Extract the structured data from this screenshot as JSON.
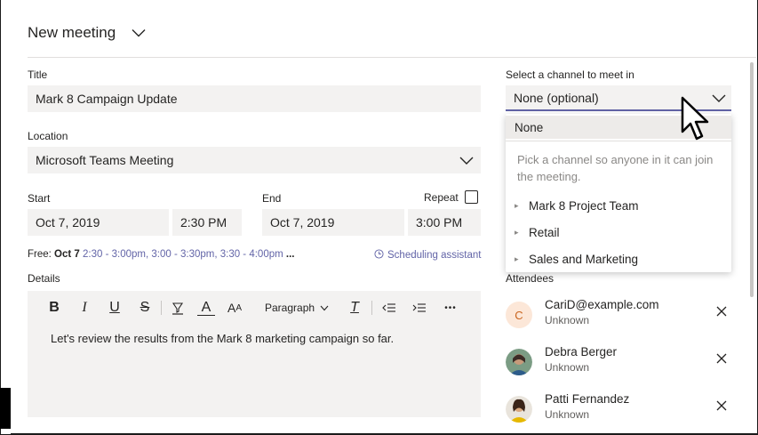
{
  "header": {
    "title": "New meeting"
  },
  "form": {
    "title_label": "Title",
    "title_value": "Mark 8 Campaign Update",
    "location_label": "Location",
    "location_value": "Microsoft Teams Meeting",
    "start_label": "Start",
    "start_date": "Oct 7, 2019",
    "start_time": "2:30 PM",
    "end_label": "End",
    "end_date": "Oct 7, 2019",
    "end_time": "3:00 PM",
    "repeat_label": "Repeat",
    "free_label": "Free:",
    "free_date": "Oct 7",
    "free_slots": [
      "2:30 - 3:00pm,",
      "3:00 - 3:30pm,",
      "3:30 - 4:00pm"
    ],
    "free_more": "...",
    "scheduling_assistant": "Scheduling assistant",
    "details_label": "Details",
    "details_text": "Let's review the results from the Mark 8 marketing campaign so far."
  },
  "toolbar": {
    "bold": "B",
    "italic": "I",
    "underline": "U",
    "strike": "S",
    "font_color": "A",
    "font_size": "A",
    "paragraph": "Paragraph",
    "clear_format": "T",
    "more": "•••"
  },
  "channel": {
    "label": "Select a channel to meet in",
    "value": "None (optional)",
    "dropdown": {
      "none_option": "None",
      "hint": "Pick a channel so anyone in it can join the meeting.",
      "items": [
        "Mark 8 Project Team",
        "Retail",
        "Sales and Marketing"
      ]
    }
  },
  "attendees": {
    "label": "Attendees",
    "list": [
      {
        "initial": "C",
        "name": "CariD@example.com",
        "role": "Unknown"
      },
      {
        "initial": "",
        "name": "Debra Berger",
        "role": "Unknown"
      },
      {
        "initial": "",
        "name": "Patti Fernandez",
        "role": "Unknown"
      }
    ]
  },
  "colors": {
    "accent": "#6264a7",
    "field_bg": "#f3f2f1",
    "text": "#252423",
    "muted": "#8a8886"
  }
}
